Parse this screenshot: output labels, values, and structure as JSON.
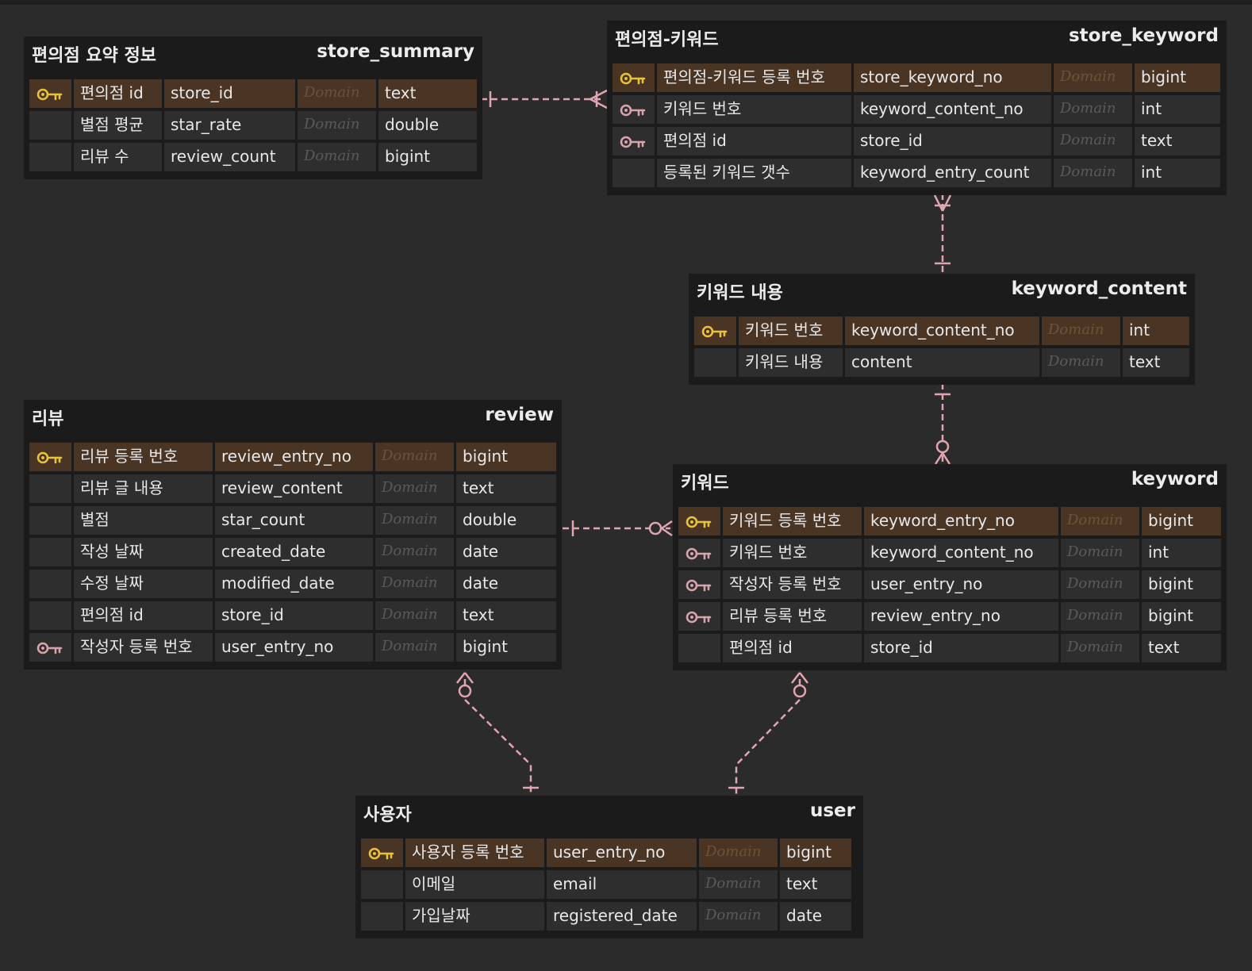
{
  "colors": {
    "background": "#2b2b2b",
    "entity": "#1b1b1b",
    "cell": "#2e2e2e",
    "pk_cell": "#4a3525",
    "pk_key": "#e8c23c",
    "fk_key": "#d9a3ad",
    "relationship": "#e0a5b0"
  },
  "domain_placeholder": "Domain",
  "entities": [
    {
      "korean_name": "편의점 요약 정보",
      "name": "store_summary",
      "columns": [
        {
          "korean": "편의점 id",
          "name": "store_id",
          "type": "text",
          "key": "pk"
        },
        {
          "korean": "별점 평균",
          "name": "star_rate",
          "type": "double",
          "key": ""
        },
        {
          "korean": "리뷰 수",
          "name": "review_count",
          "type": "bigint",
          "key": ""
        }
      ]
    },
    {
      "korean_name": "편의점-키워드",
      "name": "store_keyword",
      "columns": [
        {
          "korean": "편의점-키워드 등록 번호",
          "name": "store_keyword_no",
          "type": "bigint",
          "key": "pk"
        },
        {
          "korean": "키워드 번호",
          "name": "keyword_content_no",
          "type": "int",
          "key": "fk"
        },
        {
          "korean": "편의점 id",
          "name": "store_id",
          "type": "text",
          "key": "fk"
        },
        {
          "korean": "등록된 키워드 갯수",
          "name": "keyword_entry_count",
          "type": "int",
          "key": ""
        }
      ]
    },
    {
      "korean_name": "키워드 내용",
      "name": "keyword_content",
      "columns": [
        {
          "korean": "키워드 번호",
          "name": "keyword_content_no",
          "type": "int",
          "key": "pk"
        },
        {
          "korean": "키워드 내용",
          "name": "content",
          "type": "text",
          "key": ""
        }
      ]
    },
    {
      "korean_name": "리뷰",
      "name": "review",
      "columns": [
        {
          "korean": "리뷰 등록 번호",
          "name": "review_entry_no",
          "type": "bigint",
          "key": "pk"
        },
        {
          "korean": "리뷰 글 내용",
          "name": "review_content",
          "type": "text",
          "key": ""
        },
        {
          "korean": "별점",
          "name": "star_count",
          "type": "double",
          "key": ""
        },
        {
          "korean": "작성 날짜",
          "name": "created_date",
          "type": "date",
          "key": ""
        },
        {
          "korean": "수정 날짜",
          "name": "modified_date",
          "type": "date",
          "key": ""
        },
        {
          "korean": "편의점 id",
          "name": "store_id",
          "type": "text",
          "key": ""
        },
        {
          "korean": "작성자 등록 번호",
          "name": "user_entry_no",
          "type": "bigint",
          "key": "fk"
        }
      ]
    },
    {
      "korean_name": "키워드",
      "name": "keyword",
      "columns": [
        {
          "korean": "키워드 등록 번호",
          "name": "keyword_entry_no",
          "type": "bigint",
          "key": "pk"
        },
        {
          "korean": "키워드 번호",
          "name": "keyword_content_no",
          "type": "int",
          "key": "fk"
        },
        {
          "korean": "작성자 등록 번호",
          "name": "user_entry_no",
          "type": "bigint",
          "key": "fk"
        },
        {
          "korean": "리뷰 등록 번호",
          "name": "review_entry_no",
          "type": "bigint",
          "key": "fk"
        },
        {
          "korean": "편의점 id",
          "name": "store_id",
          "type": "text",
          "key": ""
        }
      ]
    },
    {
      "korean_name": "사용자",
      "name": "user",
      "columns": [
        {
          "korean": "사용자 등록 번호",
          "name": "user_entry_no",
          "type": "bigint",
          "key": "pk"
        },
        {
          "korean": "이메일",
          "name": "email",
          "type": "text",
          "key": ""
        },
        {
          "korean": "가입날짜",
          "name": "registered_date",
          "type": "date",
          "key": ""
        }
      ]
    }
  ],
  "relationships": [
    {
      "from": "store_summary",
      "to": "store_keyword",
      "from_cardinality": "one",
      "to_cardinality": "one-or-many"
    },
    {
      "from": "keyword_content",
      "to": "store_keyword",
      "from_cardinality": "one",
      "to_cardinality": "one-or-many"
    },
    {
      "from": "keyword_content",
      "to": "keyword",
      "from_cardinality": "one",
      "to_cardinality": "zero-or-many"
    },
    {
      "from": "review",
      "to": "keyword",
      "from_cardinality": "one",
      "to_cardinality": "zero-or-many"
    },
    {
      "from": "user",
      "to": "review",
      "from_cardinality": "one",
      "to_cardinality": "zero-or-many"
    },
    {
      "from": "user",
      "to": "keyword",
      "from_cardinality": "one",
      "to_cardinality": "zero-or-many"
    }
  ]
}
